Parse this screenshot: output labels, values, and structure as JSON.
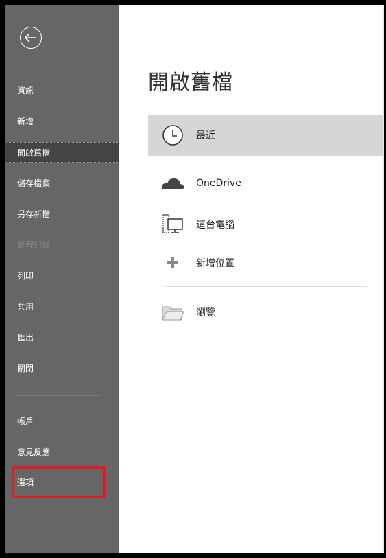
{
  "sidebar": {
    "items": [
      {
        "label": "資訊",
        "state": "normal"
      },
      {
        "label": "新增",
        "state": "normal"
      },
      {
        "label": "開啟舊檔",
        "state": "active"
      },
      {
        "label": "儲存檔案",
        "state": "normal"
      },
      {
        "label": "另存新檔",
        "state": "normal"
      },
      {
        "label": "歷程記錄",
        "state": "disabled"
      },
      {
        "label": "列印",
        "state": "normal"
      },
      {
        "label": "共用",
        "state": "normal"
      },
      {
        "label": "匯出",
        "state": "normal"
      },
      {
        "label": "關閉",
        "state": "normal"
      }
    ],
    "bottom_items": [
      {
        "label": "帳戶"
      },
      {
        "label": "意見反應"
      },
      {
        "label": "選項"
      }
    ],
    "back_icon": "back-arrow-icon",
    "colors": {
      "bg": "#666666",
      "active_bg": "#444444",
      "highlight": "#e01e26"
    }
  },
  "main": {
    "title": "開啟舊檔",
    "locations": [
      {
        "label": "最近",
        "icon": "clock-icon",
        "active": true
      },
      {
        "label": "OneDrive",
        "icon": "cloud-icon",
        "active": false
      },
      {
        "label": "這台電腦",
        "icon": "computer-icon",
        "active": false
      },
      {
        "label": "新增位置",
        "icon": "plus-icon",
        "active": false
      },
      {
        "label": "瀏覽",
        "icon": "folder-icon",
        "active": false
      }
    ]
  }
}
